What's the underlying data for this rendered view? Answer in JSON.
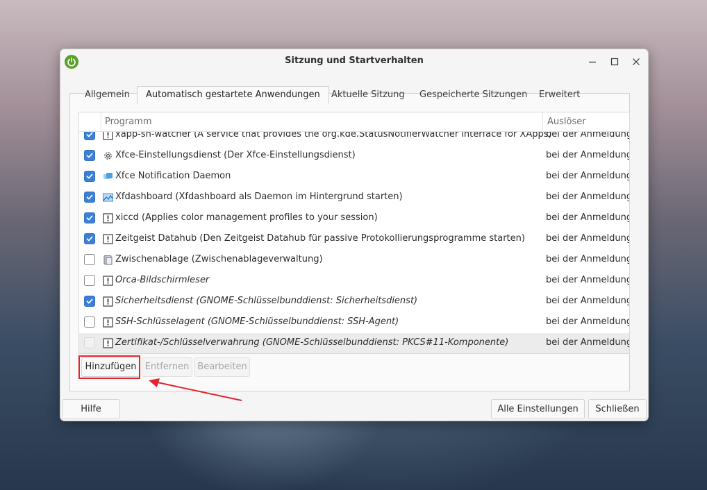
{
  "window": {
    "title": "Sitzung und Startverhalten"
  },
  "tabs": [
    {
      "label": "Allgemein"
    },
    {
      "label": "Automatisch gestartete Anwendungen"
    },
    {
      "label": "Aktuelle Sitzung"
    },
    {
      "label": "Gespeicherte Sitzungen"
    },
    {
      "label": "Erweitert"
    }
  ],
  "columns": {
    "program": "Programm",
    "trigger": "Auslöser"
  },
  "rows": [
    {
      "text": "xapp-sn-watcher (A service that provides the org.kde.StatusNotifierWatcher interface for XApps)",
      "trigger": "bei der Anmeldung",
      "checked": true,
      "icon": "warning-icon"
    },
    {
      "text": "Xfce-Einstellungsdienst (Der Xfce-Einstellungsdienst)",
      "trigger": "bei der Anmeldung",
      "checked": true,
      "icon": "gear-icon"
    },
    {
      "text": "Xfce Notification Daemon",
      "trigger": "bei der Anmeldung",
      "checked": true,
      "icon": "notification-icon"
    },
    {
      "text": "Xfdashboard (Xfdashboard als Daemon im Hintergrund starten)",
      "trigger": "bei der Anmeldung",
      "checked": true,
      "icon": "dashboard-icon"
    },
    {
      "text": "xiccd (Applies color management profiles to your session)",
      "trigger": "bei der Anmeldung",
      "checked": true,
      "icon": "warning-icon"
    },
    {
      "text": "Zeitgeist Datahub (Den Zeitgeist Datahub für passive Protokollierungsprogramme starten)",
      "trigger": "bei der Anmeldung",
      "checked": true,
      "icon": "warning-icon"
    },
    {
      "text": "Zwischenablage (Zwischenablageverwaltung)",
      "trigger": "bei der Anmeldung",
      "checked": false,
      "icon": "clipboard-icon"
    },
    {
      "text": "Orca-Bildschirmleser",
      "trigger": "bei der Anmeldung",
      "checked": false,
      "icon": "warning-icon"
    },
    {
      "text": "Sicherheitsdienst (GNOME-Schlüsselbunddienst: Sicherheitsdienst)",
      "trigger": "bei der Anmeldung",
      "checked": true,
      "icon": "warning-icon"
    },
    {
      "text": "SSH-Schlüsselagent (GNOME-Schlüsselbunddienst: SSH-Agent)",
      "trigger": "bei der Anmeldung",
      "checked": false,
      "icon": "warning-icon"
    },
    {
      "text": "Zertifikat-/Schlüsselverwahrung (GNOME-Schlüsselbunddienst: PKCS#11-Komponente)",
      "trigger": "bei der Anmeldung",
      "checked": false,
      "icon": "warning-icon"
    }
  ],
  "list_buttons": {
    "add": "Hinzufügen",
    "remove": "Entfernen",
    "edit": "Bearbeiten"
  },
  "footer": {
    "help": "Hilfe",
    "all_settings": "Alle Einstellungen",
    "close": "Schließen"
  },
  "colors": {
    "accent": "#3c7fd6",
    "annotation": "#e0262e"
  }
}
